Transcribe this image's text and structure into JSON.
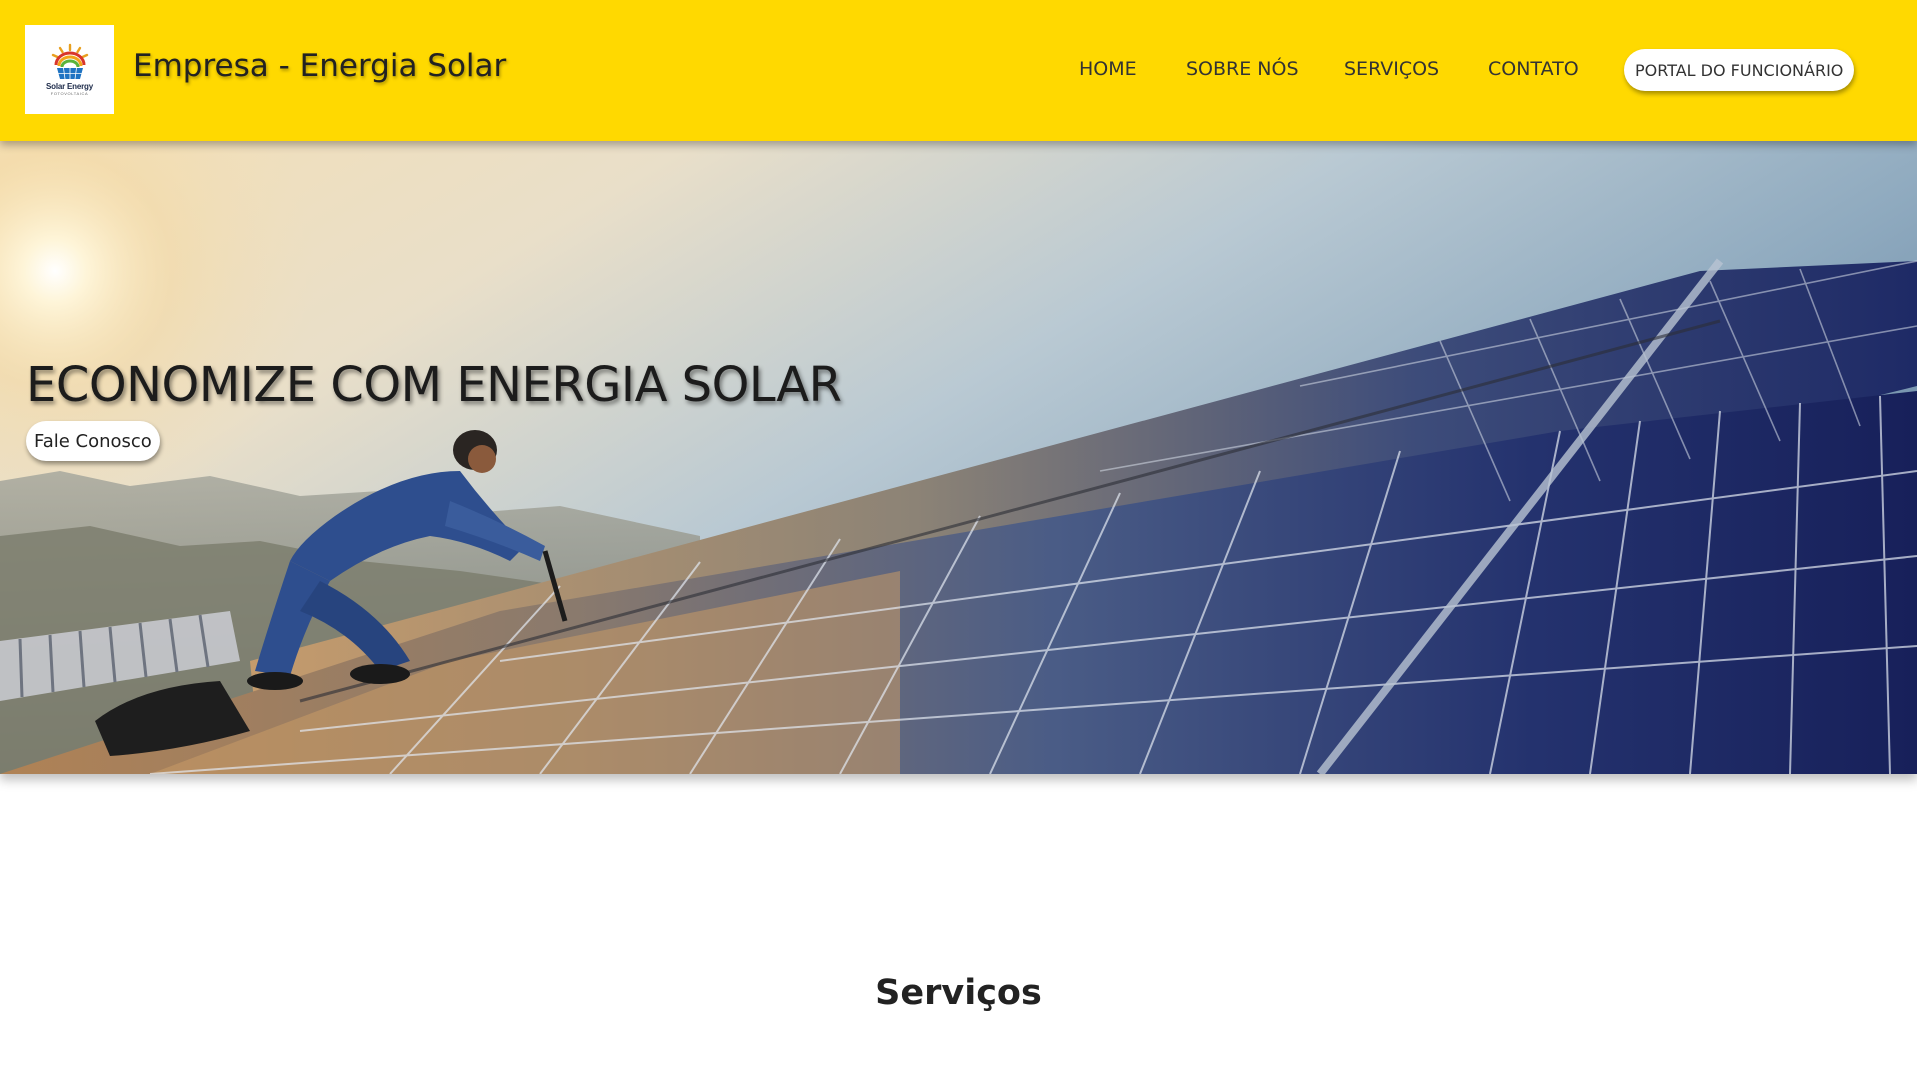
{
  "header": {
    "logo": {
      "text": "Solar Energy",
      "subtext": "FOTOVOLTAICA"
    },
    "site_title": "Empresa - Energia Solar",
    "nav": {
      "home": "HOME",
      "sobre": "SOBRE NÓS",
      "servicos": "SERVIÇOS",
      "contato": "CONTATO"
    },
    "portal_button": "PORTAL DO FUNCIONÁRIO"
  },
  "hero": {
    "title": "ECONOMIZE COM ENERGIA SOLAR",
    "button": "Fale Conosco"
  },
  "services": {
    "title": "Serviços"
  },
  "colors": {
    "header_bg": "#FFD900",
    "page_bg": "#FFFFFF",
    "button_bg": "#FFFFFF"
  },
  "icons": {
    "logo": "solar-sun-logo-icon"
  }
}
